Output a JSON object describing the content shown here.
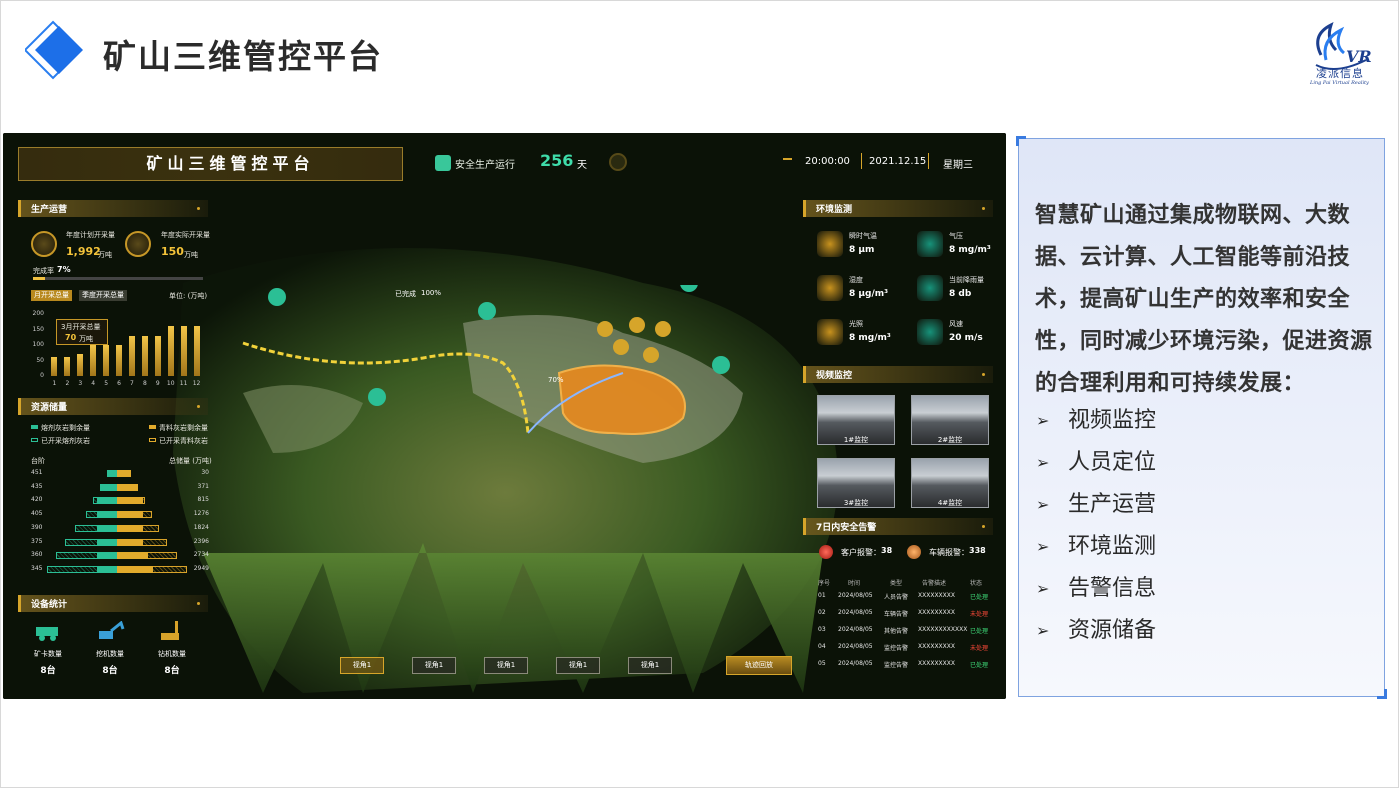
{
  "slide": {
    "title": "矿山三维管控平台",
    "logo_text": "凌派信息",
    "logo_sub": "Ling Pai Virtual Reality"
  },
  "dashboard": {
    "title": "矿山三维管控平台",
    "safety": {
      "label": "安全生产运行",
      "days": "256",
      "unit": "天"
    },
    "time": "20:00:00",
    "date": "2021.12.15",
    "weekday": "星期三",
    "production": {
      "header": "生产运营",
      "plan_label": "年度计划开采量",
      "plan_value": "1,992",
      "plan_unit": "万吨",
      "actual_label": "年度实际开采量",
      "actual_value": "150",
      "actual_unit": "万吨",
      "completion_label": "完成率",
      "completion_value": "7%",
      "completion_fraction": 0.07,
      "tab_month": "月开采总量",
      "tab_quarter": "季度开采总量",
      "unit_label": "单位: (万吨)",
      "tooltip_label": "3月开采总量",
      "tooltip_value": "70",
      "tooltip_unit": "万吨"
    },
    "resources": {
      "header": "资源储量",
      "legend": [
        "熔剂灰岩剩余量",
        "青料灰岩剩余量",
        "已开采熔剂灰岩",
        "已开采青料灰岩"
      ],
      "col_left": "台阶",
      "col_right": "总储量 (万吨)"
    },
    "devices": {
      "header": "设备统计",
      "items": [
        {
          "label": "矿卡数量",
          "value": "8台"
        },
        {
          "label": "挖机数量",
          "value": "8台"
        },
        {
          "label": "钻机数量",
          "value": "8台"
        }
      ]
    },
    "map": {
      "progress_label": "已完成",
      "progress_value": "100%",
      "progress2_value": "70%"
    },
    "view_buttons": [
      "视角1",
      "视角1",
      "视角1",
      "视角1",
      "视角1"
    ],
    "track_button": "轨迹回放",
    "environment": {
      "header": "环境监测",
      "items": [
        {
          "label": "瞬时气温",
          "value": "8 μm",
          "color": "#c8921e"
        },
        {
          "label": "气压",
          "value": "8 mg/m³",
          "color": "#17927a"
        },
        {
          "label": "湿度",
          "value": "8 μg/m³",
          "color": "#c8921e"
        },
        {
          "label": "当前降雨量",
          "value": "8 db",
          "color": "#17927a"
        },
        {
          "label": "光照",
          "value": "8 mg/m³",
          "color": "#c8921e"
        },
        {
          "label": "风速",
          "value": "20 m/s",
          "color": "#17927a"
        }
      ]
    },
    "video": {
      "header": "视频监控",
      "cams": [
        "1#监控",
        "2#监控",
        "3#监控",
        "4#监控"
      ]
    },
    "alarms": {
      "header": "7日内安全告警",
      "customer_label": "客户报警：",
      "customer_value": "38",
      "vehicle_label": "车辆报警：",
      "vehicle_value": "338",
      "columns": [
        "序号",
        "时间",
        "类型",
        "告警描述",
        "状态"
      ],
      "rows": [
        {
          "no": "01",
          "time": "2024/08/05",
          "type": "人员告警",
          "desc": "XXXXXXXXX",
          "status": "已处理",
          "ok": true
        },
        {
          "no": "02",
          "time": "2024/08/05",
          "type": "车辆告警",
          "desc": "XXXXXXXXX",
          "status": "未处理",
          "ok": false
        },
        {
          "no": "03",
          "time": "2024/08/05",
          "type": "其他告警",
          "desc": "XXXXXXXXXXXX",
          "status": "已处理",
          "ok": true
        },
        {
          "no": "04",
          "time": "2024/08/05",
          "type": "监控告警",
          "desc": "XXXXXXXXX",
          "status": "未处理",
          "ok": false
        },
        {
          "no": "05",
          "time": "2024/08/05",
          "type": "监控告警",
          "desc": "XXXXXXXXX",
          "status": "已处理",
          "ok": true
        }
      ]
    }
  },
  "chart_data": [
    {
      "type": "bar",
      "title": "月开采总量",
      "ylabel": "单位: (万吨)",
      "categories": [
        "1",
        "2",
        "3",
        "4",
        "5",
        "6",
        "7",
        "8",
        "9",
        "10",
        "11",
        "12"
      ],
      "values": [
        60,
        60,
        70,
        100,
        100,
        100,
        130,
        130,
        130,
        160,
        160,
        160
      ],
      "ylim": [
        0,
        200
      ],
      "yticks": [
        0,
        25,
        50,
        75,
        100,
        125,
        150,
        175,
        200
      ]
    },
    {
      "type": "bar",
      "title": "资源储量",
      "categories": [
        "451",
        "435",
        "420",
        "405",
        "390",
        "375",
        "360",
        "345"
      ],
      "totals": [
        "30",
        "371",
        "815",
        "1276",
        "1824",
        "2396",
        "2734",
        "2949"
      ],
      "series": [
        {
          "name": "熔剂灰岩剩余量",
          "values": [
            0.4,
            0.5,
            0.5,
            0.5,
            0.5,
            0.5,
            0.5,
            0.5
          ]
        },
        {
          "name": "青料灰岩剩余量",
          "values": [
            0.45,
            0.5,
            0.5,
            0.5,
            0.5,
            0.5,
            0.6,
            0.7
          ]
        }
      ],
      "left_extent": [
        0.15,
        0.25,
        0.35,
        0.45,
        0.6,
        0.75,
        0.87,
        1.0
      ],
      "right_extent": [
        0.2,
        0.3,
        0.4,
        0.5,
        0.6,
        0.72,
        0.85,
        1.0
      ]
    }
  ],
  "description": {
    "text": "智慧矿山通过集成物联网、大数据、云计算、人工智能等前沿技术，提高矿山生产的效率和安全性，同时减少环境污染，促进资源的合理利用和可持续发展：",
    "bullets": [
      "视频监控",
      "人员定位",
      "生产运营",
      "环境监测",
      "告警信息",
      "资源储备"
    ]
  },
  "colors": {
    "accent": "#2a7ef0",
    "gold": "#d6a52a",
    "teal": "#2bbf95"
  }
}
